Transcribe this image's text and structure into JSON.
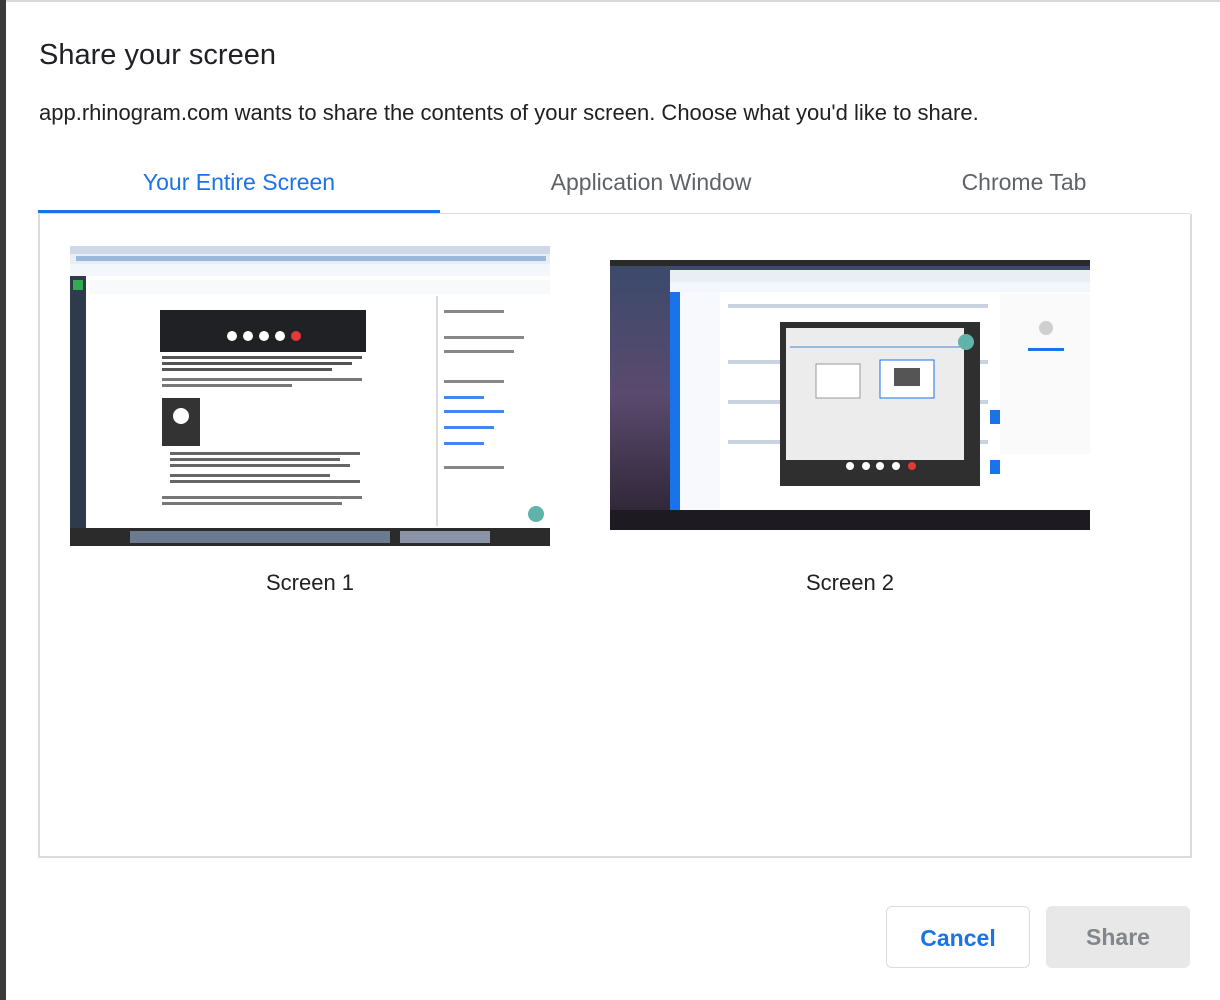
{
  "dialog": {
    "title": "Share your screen",
    "description": "app.rhinogram.com wants to share the contents of your screen. Choose what you'd like to share."
  },
  "tabs": [
    {
      "label": "Your Entire Screen",
      "active": true
    },
    {
      "label": "Application Window",
      "active": false
    },
    {
      "label": "Chrome Tab",
      "active": false
    }
  ],
  "sources": [
    {
      "label": "Screen 1"
    },
    {
      "label": "Screen 2"
    }
  ],
  "buttons": {
    "cancel": "Cancel",
    "share": "Share"
  },
  "colors": {
    "accent": "#1a73e8",
    "disabled_bg": "#e8e8e8",
    "disabled_text": "#80868b",
    "border": "#dadce0"
  }
}
